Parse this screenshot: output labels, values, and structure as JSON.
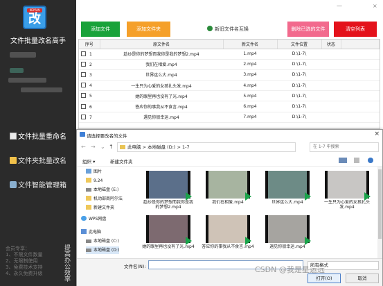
{
  "app": {
    "logo_badge": "KEIYUN",
    "logo_char": "改",
    "title": "文件批量改名高手",
    "nav": [
      {
        "label": "文件批量重命名"
      },
      {
        "label": "文件夹批量改名"
      },
      {
        "label": "文件智能管理箱"
      }
    ],
    "member_info": [
      "会员专享：",
      "1、不限文件数量",
      "2、无限制使用",
      "3、免费技术支持",
      "4、永久免费升级"
    ],
    "vertical_text": "提高办公效率",
    "window_controls": [
      "—",
      "×"
    ]
  },
  "toolbar": {
    "add_file": "添加文件",
    "add_folder": "添加文件夹",
    "new_name_preview": "新旧文件名互换",
    "delete_selected": "删除已选的文件",
    "clear_list": "清空列表"
  },
  "grid": {
    "headers": [
      "序号",
      "原文件名",
      "新文件名",
      "文件位置",
      "状态"
    ],
    "rows": [
      {
        "seq": "1",
        "original": "趁纱是你的梦想而我你是我的梦想2.mp4",
        "new": "1.mp4",
        "location": "D:\\1-7\\",
        "status": ""
      },
      {
        "seq": "2",
        "original": "我们在相爱.mp4",
        "new": "2.mp4",
        "location": "D:\\1-7\\",
        "status": ""
      },
      {
        "seq": "3",
        "original": "世界这么大.mp4",
        "new": "3.mp4",
        "location": "D:\\1-7\\",
        "status": ""
      },
      {
        "seq": "4",
        "original": "一生只为心爱的女孩扎头发.mp4",
        "new": "4.mp4",
        "location": "D:\\1-7\\",
        "status": ""
      },
      {
        "seq": "5",
        "original": "她的眼里再也没有了光.mp4",
        "new": "5.mp4",
        "location": "D:\\1-7\\",
        "status": ""
      },
      {
        "seq": "6",
        "original": "答应你的事我从不食言.mp4",
        "new": "6.mp4",
        "location": "D:\\1-7\\",
        "status": ""
      },
      {
        "seq": "7",
        "original": "遇见你很幸运.mp4",
        "new": "7.mp4",
        "location": "D:\\1-7\\",
        "status": ""
      }
    ]
  },
  "dialog": {
    "title": "请选择要改名的文件",
    "close": "×",
    "nav_arrows": [
      "←",
      "→",
      "⌄",
      "↑"
    ],
    "path": [
      "此电脑",
      "本地磁盘 (D:)",
      "1-7"
    ],
    "search_placeholder": "在 1-7 中搜索",
    "organize": "组织 ▾",
    "new_folder": "新建文件夹",
    "tree": [
      {
        "label": "图片",
        "icon": "pic"
      },
      {
        "label": "9.24",
        "icon": "fold"
      },
      {
        "label": "本地磁盘 (E:)",
        "icon": "drv"
      },
      {
        "label": "机动部商阿尔法",
        "icon": "fold"
      },
      {
        "label": "新建文件夹",
        "icon": "fold"
      },
      {
        "label": "WPS网盘",
        "icon": "cloud"
      },
      {
        "label": "此电脑",
        "icon": "pc"
      },
      {
        "label": "本地磁盘 (C:)",
        "icon": "drv"
      },
      {
        "label": "本地磁盘 (D:)",
        "icon": "drv"
      }
    ],
    "files": [
      {
        "name": "趁纱是你的梦想而我你是我的梦想2.mp4",
        "color": "#5b6f8a"
      },
      {
        "name": "我们在相爱.mp4",
        "color": "#a7b4a0"
      },
      {
        "name": "世界这么大.mp4",
        "color": "#6d8b86"
      },
      {
        "name": "一生只为心爱的女孩扎头发.mp4",
        "color": "#c8c6c4"
      },
      {
        "name": "她的眼里再也没有了光.mp4",
        "color": "#7d6a70"
      },
      {
        "name": "答应你的事我从不食言.mp4",
        "color": "#cfc3b7"
      },
      {
        "name": "遇见你很幸运.mp4",
        "color": "#a6a4a0"
      }
    ],
    "filename_label": "文件名(N):",
    "filename_value": "",
    "filetype": "所有格式",
    "open": "打开(O)",
    "cancel": "取消"
  },
  "watermark": "CSDN @我是星运远"
}
